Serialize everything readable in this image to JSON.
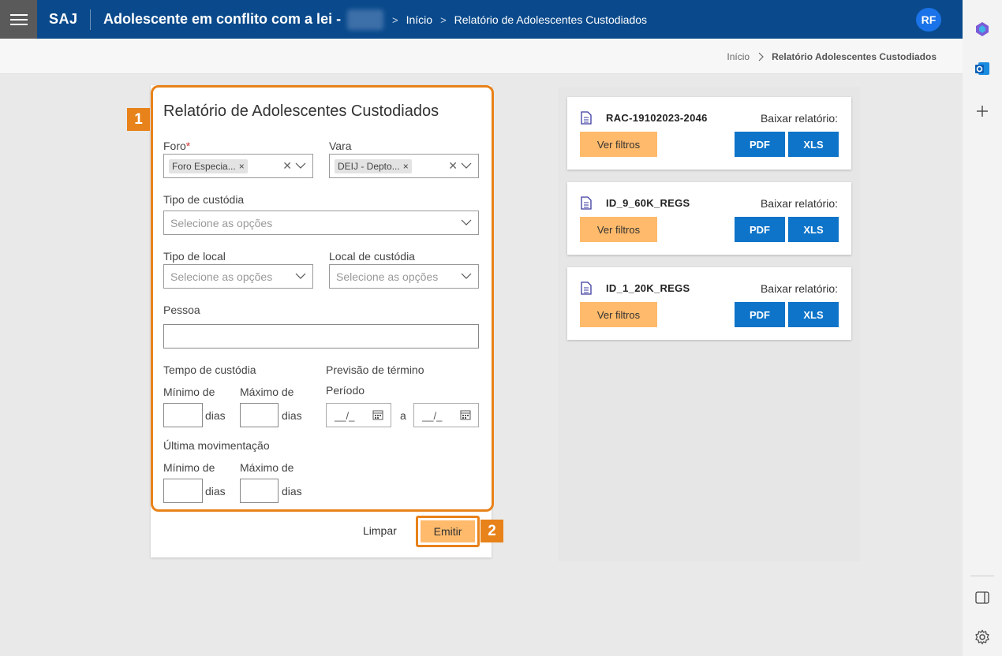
{
  "header": {
    "brand": "SAJ",
    "title": "Adolescente em conflito com a lei -",
    "crumbs": [
      "Início",
      "Relatório de Adolescentes Custodiados"
    ],
    "avatar": "RF"
  },
  "subheader": {
    "crumbs": [
      "Início",
      "Relatório Adolescentes Custodiados"
    ]
  },
  "form": {
    "badge": "1",
    "title": "Relatório de Adolescentes Custodiados",
    "foro_label": "Foro",
    "foro_required": "*",
    "foro_chip": "Foro Especia...",
    "vara_label": "Vara",
    "vara_chip": "DEIJ - Depto...",
    "tipo_custodia_label": "Tipo de custódia",
    "tipo_custodia_placeholder": "Selecione as opções",
    "tipo_local_label": "Tipo de local",
    "tipo_local_placeholder": "Selecione as opções",
    "local_custodia_label": "Local de custódia",
    "local_custodia_placeholder": "Selecione as opções",
    "pessoa_label": "Pessoa",
    "pessoa_value": "",
    "tempo_label": "Tempo de custódia",
    "minimo_label": "Mínimo de",
    "maximo_label": "Máximo de",
    "dias": "dias",
    "previsao_label": "Previsão de término",
    "periodo_label": "Período",
    "date_placeholder": "__/_",
    "date_sep": "a",
    "ultima_label": "Última movimentação",
    "limpar": "Limpar",
    "emitir": "Emitir",
    "badge2": "2"
  },
  "reports": [
    {
      "name": "RAC-19102023-2046",
      "baixar": "Baixar relatório:",
      "ver": "Ver filtros",
      "pdf": "PDF",
      "xls": "XLS"
    },
    {
      "name": "ID_9_60K_REGS",
      "baixar": "Baixar relatório:",
      "ver": "Ver filtros",
      "pdf": "PDF",
      "xls": "XLS"
    },
    {
      "name": "ID_1_20K_REGS",
      "baixar": "Baixar relatório:",
      "ver": "Ver filtros",
      "pdf": "PDF",
      "xls": "XLS"
    }
  ],
  "colors": {
    "primary": "#0a4a8c",
    "accent": "#e8821a",
    "button_blue": "#0d74c9",
    "orange_btn": "#ffba6b"
  }
}
